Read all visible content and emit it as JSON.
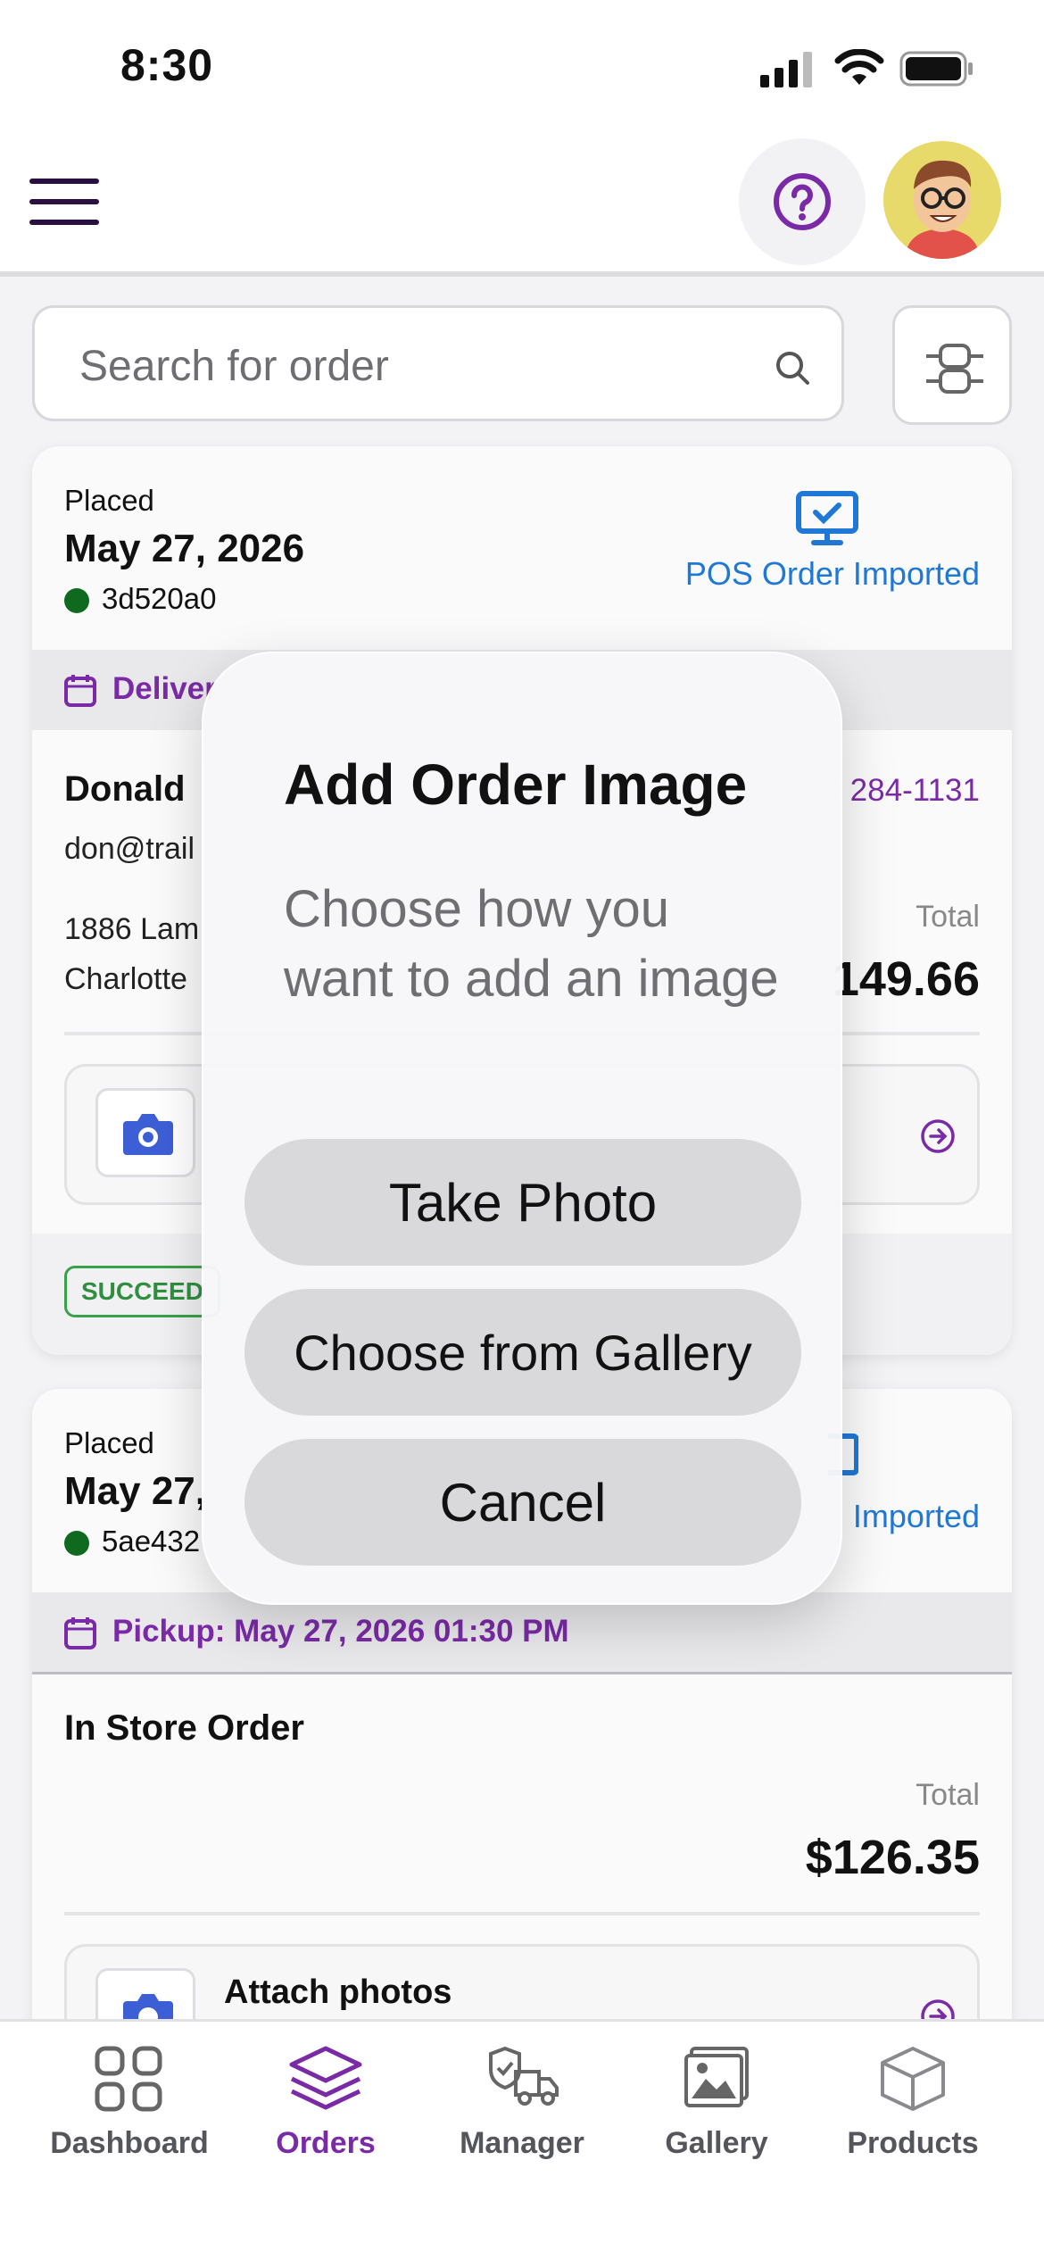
{
  "status_bar": {
    "time": "8:30"
  },
  "header": {
    "help_icon": "question-circle-icon",
    "avatar_icon": "avatar-cartoon"
  },
  "search": {
    "placeholder": "Search for order"
  },
  "orders": [
    {
      "placed_label": "Placed",
      "placed_date": "May 27, 2026",
      "order_id": "3d520a0",
      "pos_label": "POS Order Imported",
      "delivery_label": "Deliver",
      "customer_name": "Donald",
      "customer_email": "don@trail",
      "phone_partial": "284-1131",
      "address_line1": "1886 Lam",
      "address_line2": "Charlotte",
      "total_label": "Total",
      "total_value": "149.66",
      "status_badge": "SUCCEED"
    },
    {
      "placed_label": "Placed",
      "placed_date": "May 27,",
      "order_id": "5ae432",
      "pos_label": "Imported",
      "pickup_label": "Pickup: May 27, 2026 01:30 PM",
      "customer_name": "In Store Order",
      "total_label": "Total",
      "total_value": "$126.35",
      "attach_label": "Attach photos"
    }
  ],
  "dialog": {
    "title": "Add Order Image",
    "message": "Choose how you want to add an image",
    "take_photo": "Take Photo",
    "choose_gallery": "Choose from Gallery",
    "cancel": "Cancel"
  },
  "bottom_nav": [
    {
      "label": "Dashboard",
      "icon": "grid-icon",
      "active": false
    },
    {
      "label": "Orders",
      "icon": "layers-icon",
      "active": true
    },
    {
      "label": "Manager",
      "icon": "truck-icon",
      "active": false
    },
    {
      "label": "Gallery",
      "icon": "image-icon",
      "active": false
    },
    {
      "label": "Products",
      "icon": "box-icon",
      "active": false
    }
  ],
  "colors": {
    "accent": "#7a2aa6",
    "pos_blue": "#1f78d6",
    "success": "#2f8f3f"
  }
}
